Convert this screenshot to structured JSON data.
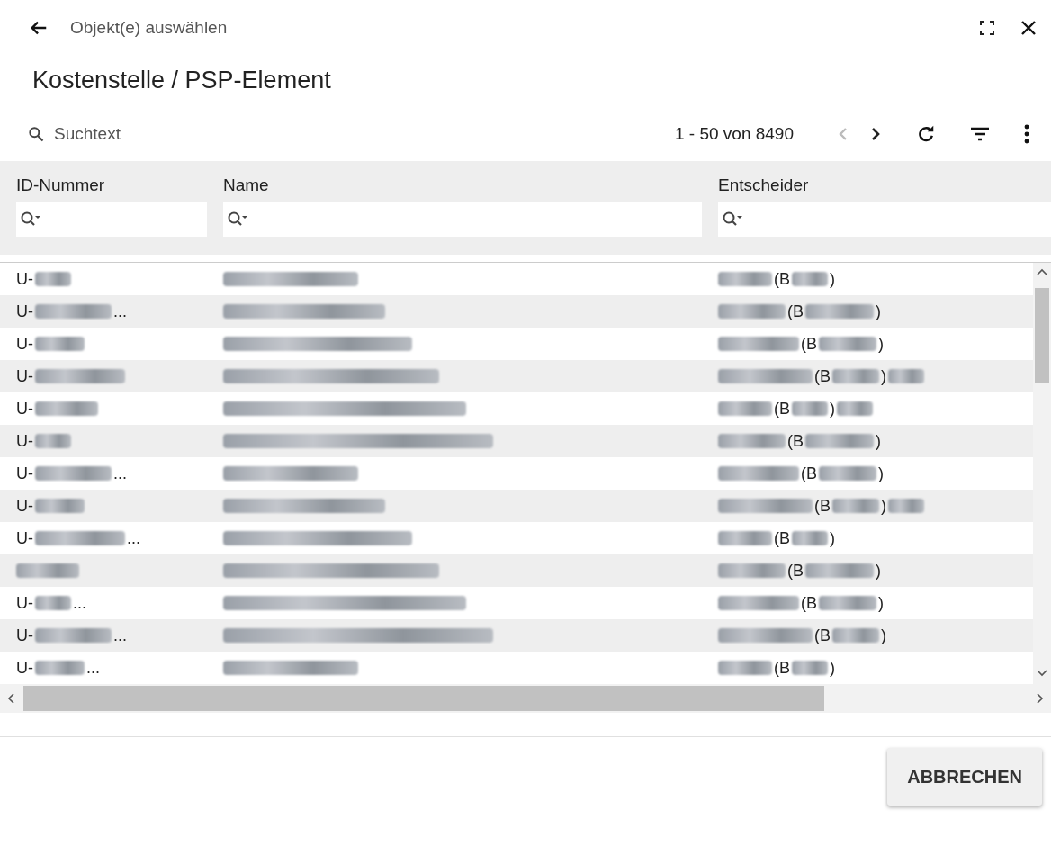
{
  "dialog": {
    "title": "Objekt(e) auswählen"
  },
  "heading": "Kostenstelle / PSP-Element",
  "toolbar": {
    "search": {
      "placeholder": "Suchtext"
    },
    "range": "1 - 50 von 8490",
    "prev_disabled": true,
    "next_disabled": false
  },
  "table": {
    "columns": [
      "ID-Nummer",
      "Name",
      "Entscheider"
    ],
    "rows": [
      {
        "id": [
          {
            "kind": "text",
            "text": "U-"
          },
          {
            "kind": "blur"
          }
        ],
        "name": [
          {
            "kind": "blur"
          }
        ],
        "decider": [
          {
            "kind": "blur"
          },
          {
            "kind": "text",
            "text": "(B"
          },
          {
            "kind": "blur"
          },
          {
            "kind": "text",
            "text": ")"
          }
        ]
      },
      {
        "id": [
          {
            "kind": "text",
            "text": "U-"
          },
          {
            "kind": "blur"
          },
          {
            "kind": "text",
            "text": "..."
          }
        ],
        "name": [
          {
            "kind": "blur"
          }
        ],
        "decider": [
          {
            "kind": "blur"
          },
          {
            "kind": "text",
            "text": "(B"
          },
          {
            "kind": "blur"
          },
          {
            "kind": "text",
            "text": ")"
          }
        ]
      },
      {
        "id": [
          {
            "kind": "text",
            "text": "U-"
          },
          {
            "kind": "blur"
          }
        ],
        "name": [
          {
            "kind": "blur"
          }
        ],
        "decider": [
          {
            "kind": "blur"
          },
          {
            "kind": "text",
            "text": "(B"
          },
          {
            "kind": "blur"
          },
          {
            "kind": "text",
            "text": ")"
          }
        ]
      },
      {
        "id": [
          {
            "kind": "text",
            "text": "U-"
          },
          {
            "kind": "blur"
          }
        ],
        "name": [
          {
            "kind": "blur"
          }
        ],
        "decider": [
          {
            "kind": "blur"
          },
          {
            "kind": "text",
            "text": "(B"
          },
          {
            "kind": "blur"
          },
          {
            "kind": "text",
            "text": ")"
          },
          {
            "kind": "blur"
          }
        ]
      },
      {
        "id": [
          {
            "kind": "text",
            "text": "U-"
          },
          {
            "kind": "blur"
          }
        ],
        "name": [
          {
            "kind": "blur"
          }
        ],
        "decider": [
          {
            "kind": "blur"
          },
          {
            "kind": "text",
            "text": "(B"
          },
          {
            "kind": "blur"
          },
          {
            "kind": "text",
            "text": ")"
          },
          {
            "kind": "blur"
          }
        ]
      },
      {
        "id": [
          {
            "kind": "text",
            "text": "U-"
          },
          {
            "kind": "blur"
          }
        ],
        "name": [
          {
            "kind": "blur"
          }
        ],
        "decider": [
          {
            "kind": "blur"
          },
          {
            "kind": "text",
            "text": "(B"
          },
          {
            "kind": "blur"
          },
          {
            "kind": "text",
            "text": ")"
          }
        ]
      },
      {
        "id": [
          {
            "kind": "text",
            "text": "U-"
          },
          {
            "kind": "blur"
          },
          {
            "kind": "text",
            "text": "..."
          }
        ],
        "name": [
          {
            "kind": "blur"
          }
        ],
        "decider": [
          {
            "kind": "blur"
          },
          {
            "kind": "text",
            "text": "(B"
          },
          {
            "kind": "blur"
          },
          {
            "kind": "text",
            "text": ")"
          }
        ]
      },
      {
        "id": [
          {
            "kind": "text",
            "text": "U-"
          },
          {
            "kind": "blur"
          }
        ],
        "name": [
          {
            "kind": "blur"
          }
        ],
        "decider": [
          {
            "kind": "blur"
          },
          {
            "kind": "text",
            "text": "(B"
          },
          {
            "kind": "blur"
          },
          {
            "kind": "text",
            "text": ")"
          },
          {
            "kind": "blur"
          }
        ]
      },
      {
        "id": [
          {
            "kind": "text",
            "text": "U-"
          },
          {
            "kind": "blur"
          },
          {
            "kind": "text",
            "text": "..."
          }
        ],
        "name": [
          {
            "kind": "blur"
          }
        ],
        "decider": [
          {
            "kind": "blur"
          },
          {
            "kind": "text",
            "text": "(B"
          },
          {
            "kind": "blur"
          },
          {
            "kind": "text",
            "text": ")"
          }
        ]
      },
      {
        "id": [
          {
            "kind": "blur"
          }
        ],
        "name": [
          {
            "kind": "blur"
          }
        ],
        "decider": [
          {
            "kind": "blur"
          },
          {
            "kind": "text",
            "text": "(B"
          },
          {
            "kind": "blur"
          },
          {
            "kind": "text",
            "text": ")"
          }
        ]
      },
      {
        "id": [
          {
            "kind": "text",
            "text": "U-"
          },
          {
            "kind": "blur"
          },
          {
            "kind": "text",
            "text": "..."
          }
        ],
        "name": [
          {
            "kind": "blur"
          }
        ],
        "decider": [
          {
            "kind": "blur"
          },
          {
            "kind": "text",
            "text": "(B"
          },
          {
            "kind": "blur"
          },
          {
            "kind": "text",
            "text": ")"
          }
        ]
      },
      {
        "id": [
          {
            "kind": "text",
            "text": "U-"
          },
          {
            "kind": "blur"
          },
          {
            "kind": "text",
            "text": "..."
          }
        ],
        "name": [
          {
            "kind": "blur"
          }
        ],
        "decider": [
          {
            "kind": "blur"
          },
          {
            "kind": "text",
            "text": "(B"
          },
          {
            "kind": "blur"
          },
          {
            "kind": "text",
            "text": ")"
          }
        ]
      },
      {
        "id": [
          {
            "kind": "text",
            "text": "U-"
          },
          {
            "kind": "blur"
          },
          {
            "kind": "text",
            "text": "..."
          }
        ],
        "name": [
          {
            "kind": "blur"
          }
        ],
        "decider": [
          {
            "kind": "blur"
          },
          {
            "kind": "text",
            "text": "(B"
          },
          {
            "kind": "blur"
          },
          {
            "kind": "text",
            "text": ")"
          }
        ]
      }
    ]
  },
  "buttons": [
    "ABBRECHEN"
  ]
}
